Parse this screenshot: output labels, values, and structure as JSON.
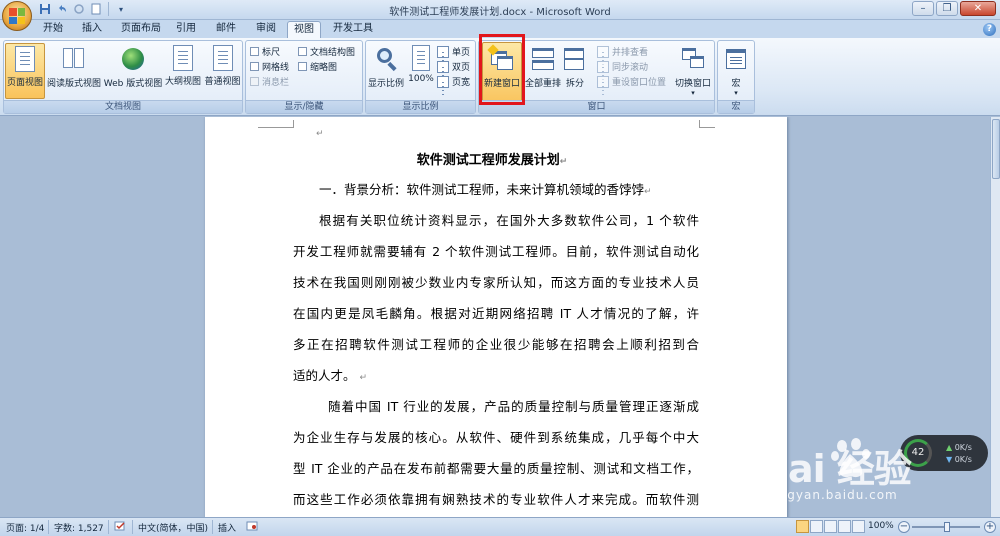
{
  "window": {
    "title": "软件测试工程师发展计划.docx - Microsoft Word"
  },
  "tabs": [
    "开始",
    "插入",
    "页面布局",
    "引用",
    "邮件",
    "审阅",
    "视图",
    "开发工具"
  ],
  "active_tab": "视图",
  "ribbon": {
    "doc_views": {
      "label": "文档视图",
      "buttons": [
        "页面视图",
        "阅读版式视图",
        "Web 版式视图",
        "大纲视图",
        "普通视图"
      ]
    },
    "show_hide": {
      "label": "显示/隐藏",
      "ruler": "标尺",
      "gridlines": "网格线",
      "message_bar": "消息栏",
      "doc_map": "文档结构图",
      "thumbnails": "缩略图"
    },
    "zoom": {
      "label": "显示比例",
      "zoom_btn": "显示比例",
      "hundred": "100%",
      "one_page": "单页",
      "two_pages": "双页",
      "page_width": "页宽"
    },
    "window": {
      "label": "窗口",
      "new_window": "新建窗口",
      "arrange_all": "全部重排",
      "split": "拆分",
      "side_by_side": "并排查看",
      "sync_scroll": "同步滚动",
      "reset_position": "重设窗口位置",
      "switch_windows": "切换窗口"
    },
    "macros": {
      "label": "宏",
      "macro_btn": "宏"
    }
  },
  "document": {
    "title": "软件测试工程师发展计划",
    "heading1": "一．背景分析：软件测试工程师，未来计算机领域的香饽饽",
    "p1_lines": [
      "根据有关职位统计资料显示，在国外大多数软件公司，1 个软件",
      "开发工程师就需要辅有 2 个软件测试工程师。目前，软件测试自动化",
      "技术在我国则刚刚被少数业内专家所认知，而这方面的专业技术人员",
      "在国内更是凤毛麟角。根据对近期网络招聘 IT 人才情况的了解，许",
      "多正在招聘软件测试工程师的企业很少能够在招聘会上顺利招到合",
      "适的人才。"
    ],
    "p2_lines": [
      "随着中国 IT 行业的发展，产品的质量控制与质量管理正逐渐成",
      "为企业生存与发展的核心。从软件、硬件到系统集成，几乎每个中大",
      "型 IT 企业的产品在发布前都需要大量的质量控制、测试和文档工作，",
      "而这些工作必须依靠拥有娴熟技术的专业软件人才来完成。而软件测"
    ]
  },
  "net_widget": {
    "percent": "42",
    "up": "0K/s",
    "down": "0K/s"
  },
  "watermark": {
    "brand": "Bai  经验",
    "url": "jingyan.baidu.com"
  },
  "statusbar": {
    "page": "页面: 1/4",
    "words": "字数: 1,527",
    "language": "中文(简体，中国)",
    "insert": "插入",
    "zoom": "100%"
  },
  "colors": {
    "highlight": "#e2161c",
    "active_button": "#f9c35b"
  }
}
